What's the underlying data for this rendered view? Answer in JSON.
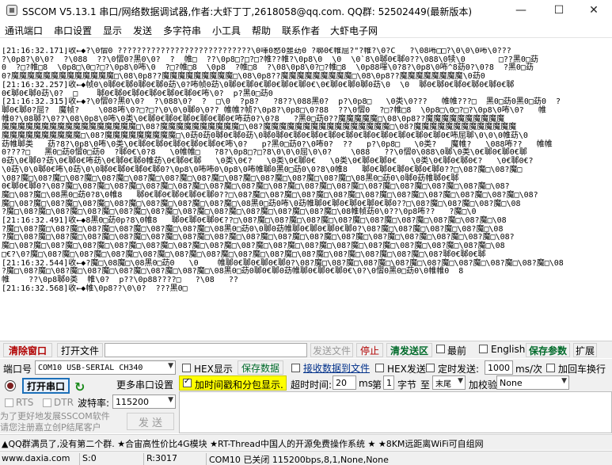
{
  "window": {
    "title": "SSCOM V5.13.1 串口/网络数据调试器,作者:大虾丁丁,2618058@qq.com. QQ群: 52502449(最新版本)",
    "minimize": "—",
    "maximize": "☐",
    "close": "✕"
  },
  "menu": [
    "通讯端口",
    "串口设置",
    "显示",
    "发送",
    "多字符串",
    "小工具",
    "帮助",
    "联系作者",
    "大虾电子网"
  ],
  "output": {
    "lines": [
      "[21:16:32.171]收←◆?\\0慴0 ????????????????????????????\\0喗0慭0噩苭0 ?郰0€帷屈?\"?帷?\\0?C   ?\\08咘□□?\\0\\0\\0咘\\0???",
      "?\\0p8?\\0\\0?  ?\\088  ??\\0慴0?黑0\\0?  ?  帷□  ??\\0p8□?□?□?帷??帷?\\0p8\\0  \\0  \\0`8\\0郰0€郰0??\\088\\0犊\\0       □??黑0□苭",
      "0  ?□?帷□8  \\0p8□\\0□?□?\\0p8\\0咘\\0  ?□?帷□8  \\0p8  ?帷□8  ?\\08\\0p8\\0?□?帷□8  \\0p88喗\\0?8?\\0p8\\0咘^8苭0?\\0?8  ?黑0□苭",
      "0?魔魔魔魔魔魔魔魔魔魔魔魔魔□\\08\\0p8??魔魔魔魔魔魔魔魔魔□\\08\\0p8??魔魔魔魔魔魔魔魔魔□\\08\\0p8??魔魔魔魔魔魔魔魔\\0苭0",
      "[21:16:32.257]收←◆帧0\\0郰0€郰0郰0€郰0苭\\0?咘帧0苭\\0郰0€郰0€郰0€郰0€郰0€\\0€郰0€郰0郰0苭\\0  \\0  郰0€郰0€郰0€郰0€郰0€郰",
      "0€郰0€郰0苭\\0?  □    郰0€郰0€郰0€郰0€郰0€郰0€咘\\0?  p?黑0□苭0",
      "[21:16:32.315]收←◆?\\0慴0?黑0\\0?  ?\\088\\0?  ?  □\\0  ?p8?   ?8??\\088黑0?  p?\\0p8□   \\0类\\0???   帷帷???□  黑0□苭0黑0□苭0  ?",
      "郰0€郰0?屈?  魔帧?    \\088咘\\0?□?□?\\0\\0\\0郰0\\0?? 帷帷?帧?\\0p8?\\0p8□\\0?88  ??\\0慴0  ?□?帷□8  \\0p8□\\0□?□?\\0p8\\0咘\\0?   帷",
      "帷0?\\08郰?\\0??\\08\\0p8\\0咘\\0类\\0€郰0€郰0€郰0€郰0€郰0€咘苭0?\\0?8   ?黑0□苭0??魔魔魔魔魔□\\08\\0p8??魔魔魔魔魔魔魔魔魔魔",
      "魔魔魔魔魔魔魔魔魔魔魔魔魔魔魔魔魔□\\08?魔魔魔魔魔魔魔魔魔魔□\\08?魔魔魔魔魔魔魔魔魔魔魔魔魔魔魔魔□\\08?魔魔魔魔魔魔魔魔魔魔魔魔魔",
      "魔魔魔魔魔魔魔魔魔魔□\\08?魔魔魔魔魔魔魔魔魔□\\0苭0苭0郰0€郰0苭\\0郰0郰0€郰0€郰0€郰0€郰0€郰0€郰0€郰0€郰0€郰0€咘屈郰\\0\\0\\0帷苭\\0",
      "苭帷郰类   苭?8?\\0p8\\0咘\\0类\\0€郰0€郰0€郰0€郰0€郰0€咘\\0?   p?黑0□苭0?\\0咘0?  ??   p?\\0p8□   \\0类?   魔帷?   \\088咘??   帷帷",
      "0????□   黑0□苭0慴0□苭0  ?郰0€\\0?8   \\0帷帷□   ?8?\\0p8□?□?8\\0\\0\\0屈\\0\\0?    \\088   ??\\0慴0\\088\\0郰\\0类\\0€郰0€郰0€郰",
      "0苭\\0€郰0?苭\\0€郰0€咘苭\\0€郰0€郰0帷苭\\0€郰0€郰   \\0类\\0€?   \\0类\\0€郰0€   \\0类\\0€郰0€郰0€   \\0类\\0€郰0€郰0€?   \\0€郰0€?",
      "\\0苭\\0\\0郰0€咘\\0苭\\0\\0郰0€郰0€郰0€郰0?\\0p8\\0咘咘0\\0p8\\0咘帷郰0黑0□苭0\\0?8\\0帷8   郰0€郰0€郰0€郰0€郰0??□\\08?魔□\\08?魔□",
      "\\08?魔□\\08?魔□\\08?魔□\\08?魔□\\08?魔□\\08?魔□\\08?魔□\\08?魔□\\08?魔□\\08?魔□\\08?魔□\\08黑0□苭0\\0郰0苭帷郰0€郰",
      "0€郰0€郰0?\\08?魔□\\08?魔□\\08?魔□\\08?魔□\\08?魔□\\08?魔□\\08?魔□\\08?魔□\\08?魔□\\08?魔□\\08?魔□\\08?魔□\\08?魔□\\08?魔□\\08?",
      "魔□\\08?魔□\\08黑0□苭0?8\\0帷8   郰0€郰0€郰0€郰0€郰0??□\\08?魔□\\08?魔□\\08?魔□\\08?魔□\\08?魔□\\08?魔□\\08?魔□\\08?魔□\\08?魔□\\08?",
      "魔□\\08?魔□\\08?魔□\\08?魔□\\08?魔□\\08?魔□\\08?魔□\\08?魔□\\08黑0□苭0咘\\0苭帷郰0€郰0€郰0€郰0€郰0??□\\08?魔□\\08?魔□\\08?魔□\\08",
      "?魔□\\08?魔□\\08?魔□\\08?魔□\\08?魔□\\08?魔□\\08?魔□\\08?魔□\\08?魔□\\08?魔□\\08?魔□\\08帷帧苭0\\0??\\0p8咘??   ?魔□\\0",
      "[21:16:32.491]收←◆8黑0□苭0p?8\\0帷8   郰0€郰0€郰0€??□\\08?魔□\\08?魔□\\08?魔□\\08?魔□\\08?魔□\\08?魔□\\08?魔□\\08?魔□\\08",
      "?魔□\\08?魔□\\08?魔□\\08?魔□\\08?魔□\\08?魔□\\08?魔□\\08黑0□苭0\\0郰0苭帷郰0€郰0€郰0€郰0?\\08?魔□\\08?魔□\\08?魔□\\08?魔□\\08",
      "?魔□\\08?魔□\\08?魔□\\08?魔□\\08?魔□\\08?魔□\\08?魔□\\08?魔□\\08?魔□\\08?魔□\\08?魔□\\08?魔□\\08?魔□\\08?魔□\\08?魔□\\08?魔□\\08?",
      "魔□\\08?魔□\\08?魔□\\08?魔□\\08?魔□\\08?魔□\\08?魔□\\08?魔□\\08?魔□\\08?魔□\\08?魔□\\08?魔□\\08?魔□\\08?魔□\\08?魔□\\08?魔□\\08",
      "□€?\\0?魔□\\08?魔□\\08?魔□\\08?魔□\\08?魔□\\08?魔□\\08?魔□\\08?魔□\\08?魔□\\08?魔□\\08?魔□\\08?魔□\\08?魔□\\08?郰0€郰0€郰",
      "[21:16:32.544]收←◆?魔□\\08魔□\\08黑0□苭0   \\0    帷郰0€郰0€郰0€郰0?\\08?魔□\\08?魔□\\08?魔□\\08?魔□\\08?魔□\\08?魔□\\08?魔□\\08?魔□\\08",
      "?魔□\\08?魔□\\08?魔□\\08?魔□\\08?魔□\\08?魔□\\08?魔□\\08黑0□苭0郰0€郰0苭帷郰0€郰0€郰0€\\0?\\0慴0黑0□苭0\\0帷帷0  8",
      "帷    ??\\0p8郰0类  帷\\0?  p??\\0p88????□   ?\\08   ??",
      "[21:16:32.568]收←◆帷\\0p8??\\0\\0?  ???黑0□"
    ]
  },
  "toolbar": {
    "clear_window": "清除窗口",
    "open_file": "打开文件",
    "send_file": "发送文件",
    "stop": "停止",
    "clear_send_area": "清发送区",
    "option_first": "最前",
    "english": "English",
    "save_params": "保存参数",
    "expand": "扩展"
  },
  "port": {
    "label": "端口号",
    "value": "COM10 USB-SERIAL CH340",
    "hex_display": "HEX显示",
    "save_data": "保存数据",
    "receive_to_file": "接收数据到文件",
    "hex_send": "HEX发送",
    "timed_send": "定时发送:",
    "interval_value": "1000",
    "interval_unit": "ms/次",
    "add_crlf": "加回车换行"
  },
  "controls": {
    "open_port": "打开串口",
    "more_settings": "更多串口设置",
    "timestamp_label": "加时间戳和分包显示.",
    "timeout_label": "超时时间:",
    "timeout_value": "20",
    "timeout_unit": "ms",
    "byte_label_1": "第",
    "byte_value": "1",
    "byte_label_2": "字节",
    "byte_to": "至",
    "byte_end": "末尾",
    "checksum_label": "加校验",
    "checksum_value": "None",
    "rts": "RTS",
    "dtr": "DTR",
    "baud_label": "波特率:",
    "baud_value": "115200",
    "send": "发 送",
    "promo_line1": "为了更好地发展SSCOM软件",
    "promo_line2": "请您注册嘉立创P结尾客户"
  },
  "adbar": {
    "text": "▲QQ群满员了,没有第二个群. ★合宙高性价比4G模块 ★RT-Thread中国人的开源免费操作系统 ★ ★8KM远距离WiFi可自组网"
  },
  "status": {
    "website": "www.daxia.com",
    "sent": "S:0",
    "received": "R:3017",
    "port_state": "COM10 已关闭  115200bps,8,1,None,None"
  },
  "colors": {
    "accent_red": "#b00000",
    "accent_green": "#006a2a",
    "highlight_yellow": "#ffff00"
  }
}
